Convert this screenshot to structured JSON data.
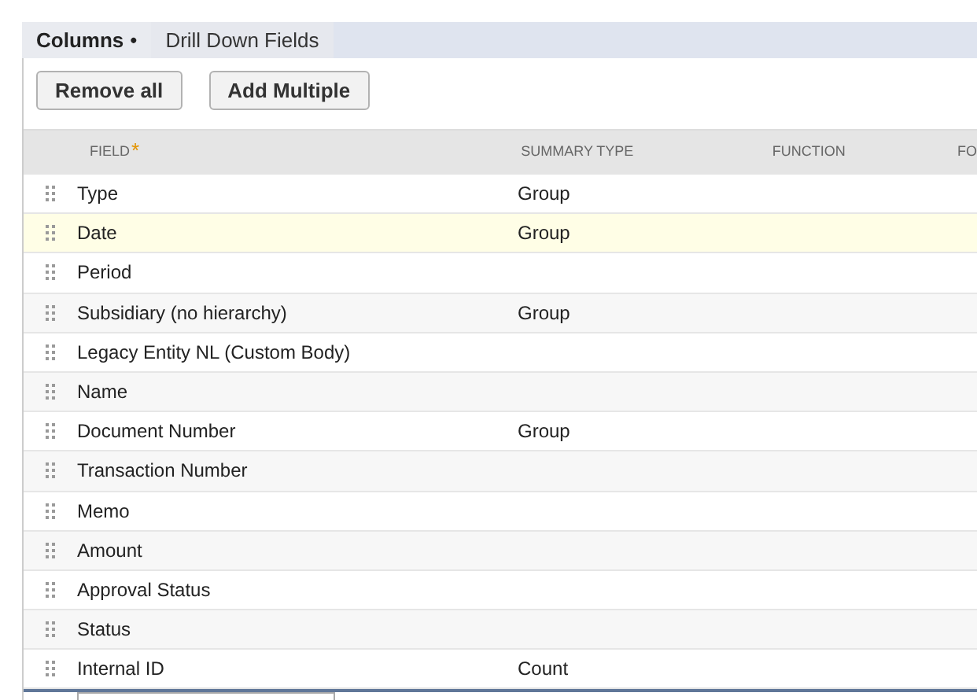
{
  "tabs": [
    {
      "label": "Columns",
      "marker": "•",
      "selected": true
    },
    {
      "label": "Drill Down Fields",
      "selected": false
    }
  ],
  "buttons": [
    "Remove all",
    "Add Multiple"
  ],
  "table": {
    "columns": [
      {
        "label": "FIELD",
        "required_mark": "*"
      },
      {
        "label": "SUMMARY TYPE"
      },
      {
        "label": "FUNCTION"
      },
      {
        "label": "FO"
      }
    ],
    "rows": [
      {
        "field": "Type",
        "summary_type": "Group",
        "selected": false
      },
      {
        "field": "Date",
        "summary_type": "Group",
        "selected": true
      },
      {
        "field": "Period",
        "selected": false
      },
      {
        "field": "Subsidiary (no hierarchy)",
        "summary_type": "Group",
        "selected": false
      },
      {
        "field": "Legacy Entity NL (Custom Body)",
        "selected": false
      },
      {
        "field": "Name",
        "selected": false
      },
      {
        "field": "Document Number",
        "summary_type": "Group",
        "selected": false
      },
      {
        "field": "Transaction Number",
        "selected": false
      },
      {
        "field": "Memo",
        "selected": false
      },
      {
        "field": "Amount",
        "selected": false
      },
      {
        "field": "Approval Status",
        "selected": false
      },
      {
        "field": "Status",
        "selected": false
      },
      {
        "field": "Internal ID",
        "summary_type": "Count",
        "selected": false
      }
    ]
  }
}
